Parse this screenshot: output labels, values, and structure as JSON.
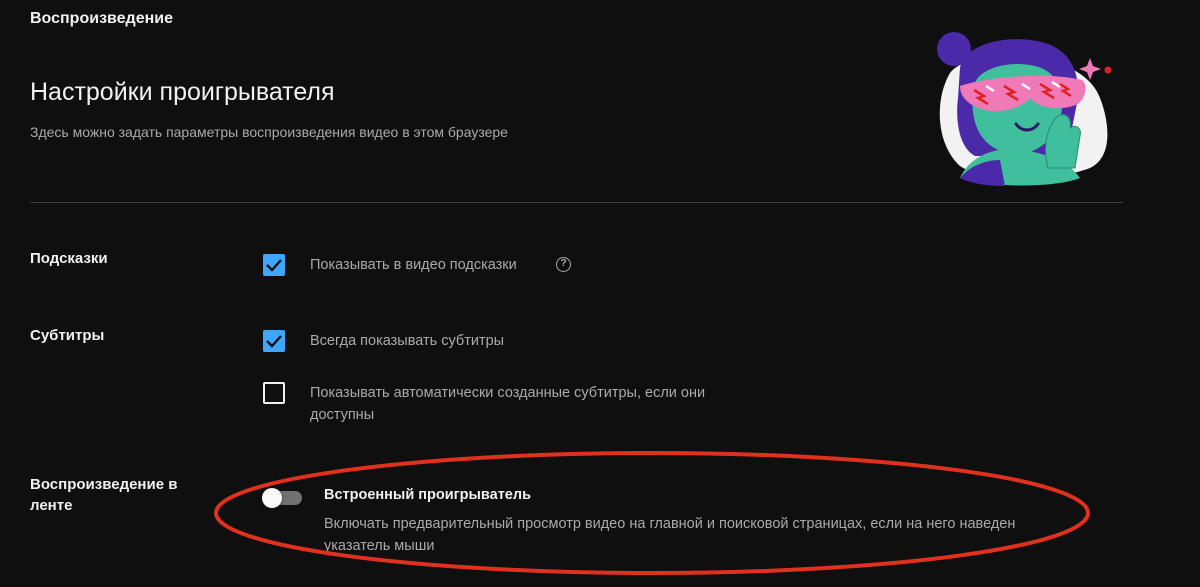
{
  "section_title": "Воспроизведение",
  "heading": "Настройки проигрывателя",
  "description": "Здесь можно задать параметры воспроизведения видео в этом браузере",
  "rows": {
    "hints": {
      "label": "Подсказки",
      "option": {
        "text": "Показывать в видео подсказки",
        "checked": true,
        "help_icon": "question-circle-icon"
      }
    },
    "subtitles": {
      "label": "Субтитры",
      "options": [
        {
          "text": "Всегда показывать субтитры",
          "checked": true
        },
        {
          "text": "Показывать автоматически созданные субтитры, если они",
          "text2": "доступны",
          "checked": false
        }
      ]
    },
    "inline": {
      "label_line1": "Воспроизведение в",
      "label_line2": "ленте",
      "toggle_on": false,
      "title": "Встроенный проигрыватель",
      "desc_line1": "Включать предварительный просмотр видео на главной и поисковой страницах, если на него наведен",
      "desc_line2": "указатель мыши"
    }
  },
  "colors": {
    "background": "#0f0f0f",
    "checkbox_accent": "#3ea6ff",
    "annotation": "#e0301e"
  }
}
